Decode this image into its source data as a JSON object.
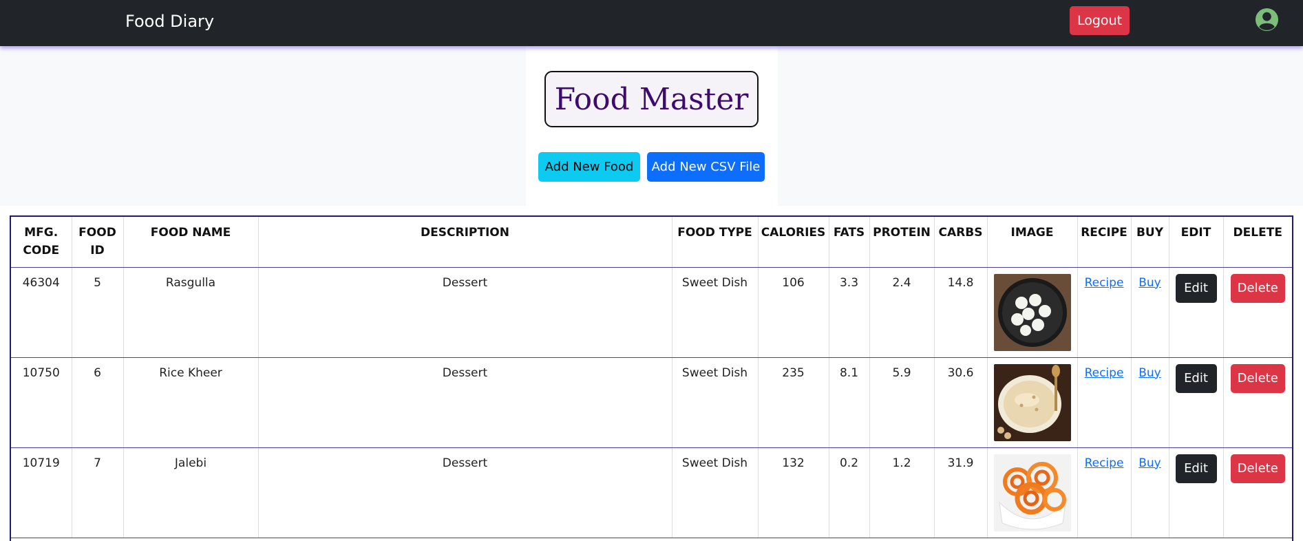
{
  "navbar": {
    "brand": "Food Diary",
    "logout_label": "Logout",
    "avatar_icon": "user-circle-icon",
    "colors": {
      "background": "#212529",
      "logout": "#dc3545",
      "avatar": "#7dbd7a"
    }
  },
  "header": {
    "title": "Food Master",
    "add_food_label": "Add New Food",
    "add_csv_label": "Add New CSV File"
  },
  "table": {
    "columns": {
      "mfg_code": "MFG. CODE",
      "food_id": "FOOD ID",
      "food_name": "FOOD NAME",
      "description": "DESCRIPTION",
      "food_type": "FOOD TYPE",
      "calories": "CALORIES",
      "fats": "FATS",
      "protein": "PROTEIN",
      "carbs": "CARBS",
      "image": "IMAGE",
      "recipe": "RECIPE",
      "buy": "BUY",
      "edit": "EDIT",
      "delete": "DELETE"
    },
    "rows": [
      {
        "mfg_code": "46304",
        "food_id": "5",
        "food_name": "Rasgulla",
        "description": "Dessert",
        "food_type": "Sweet Dish",
        "calories": "106",
        "fats": "3.3",
        "protein": "2.4",
        "carbs": "14.8",
        "image_icon": "rasgulla-image",
        "recipe_label": "Recipe",
        "buy_label": "Buy",
        "edit_label": "Edit",
        "delete_label": "Delete"
      },
      {
        "mfg_code": "10750",
        "food_id": "6",
        "food_name": "Rice Kheer",
        "description": "Dessert",
        "food_type": "Sweet Dish",
        "calories": "235",
        "fats": "8.1",
        "protein": "5.9",
        "carbs": "30.6",
        "image_icon": "rice-kheer-image",
        "recipe_label": "Recipe",
        "buy_label": "Buy",
        "edit_label": "Edit",
        "delete_label": "Delete"
      },
      {
        "mfg_code": "10719",
        "food_id": "7",
        "food_name": "Jalebi",
        "description": "Dessert",
        "food_type": "Sweet Dish",
        "calories": "132",
        "fats": "0.2",
        "protein": "1.2",
        "carbs": "31.9",
        "image_icon": "jalebi-image",
        "recipe_label": "Recipe",
        "buy_label": "Buy",
        "edit_label": "Edit",
        "delete_label": "Delete"
      }
    ]
  }
}
